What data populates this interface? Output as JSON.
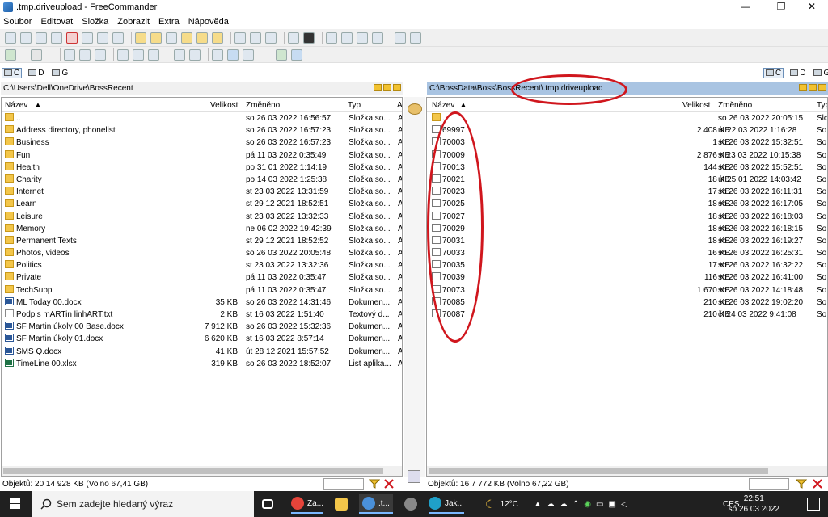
{
  "window": {
    "title": ".tmp.driveupload - FreeCommander",
    "controls": [
      "—",
      "❐",
      "✕"
    ]
  },
  "menu": [
    "Soubor",
    "Editovat",
    "Složka",
    "Zobrazit",
    "Extra",
    "Nápověda"
  ],
  "drives": [
    "C",
    "D",
    "G"
  ],
  "left_panel": {
    "path": "C:\\Users\\Dell\\OneDrive\\BossRecent",
    "columns": {
      "name": "Název",
      "size": "Velikost",
      "modified": "Změněno",
      "type": "Typ",
      "attr": "A"
    },
    "rows": [
      {
        "icon": "folder",
        "name": "..",
        "size": "",
        "modified": "so 26 03 2022 16:56:57",
        "type": "Složka so...",
        "attr": "A"
      },
      {
        "icon": "folder",
        "name": "Address directory, phonelist",
        "size": "",
        "modified": "so 26 03 2022 16:57:23",
        "type": "Složka so...",
        "attr": "A"
      },
      {
        "icon": "folder",
        "name": "Business",
        "size": "",
        "modified": "so 26 03 2022 16:57:23",
        "type": "Složka so...",
        "attr": "A"
      },
      {
        "icon": "folder",
        "name": "Fun",
        "size": "",
        "modified": "pá 11 03 2022 0:35:49",
        "type": "Složka so...",
        "attr": "A"
      },
      {
        "icon": "folder",
        "name": "Health",
        "size": "",
        "modified": "po 31 01 2022 1:14:19",
        "type": "Složka so...",
        "attr": "A"
      },
      {
        "icon": "folder",
        "name": "Charity",
        "size": "",
        "modified": "po 14 03 2022 1:25:38",
        "type": "Složka so...",
        "attr": "A"
      },
      {
        "icon": "folder",
        "name": "Internet",
        "size": "",
        "modified": "st 23 03 2022 13:31:59",
        "type": "Složka so...",
        "attr": "A"
      },
      {
        "icon": "folder",
        "name": "Learn",
        "size": "",
        "modified": "st 29 12 2021 18:52:51",
        "type": "Složka so...",
        "attr": "A"
      },
      {
        "icon": "folder",
        "name": "Leisure",
        "size": "",
        "modified": "st 23 03 2022 13:32:33",
        "type": "Složka so...",
        "attr": "A"
      },
      {
        "icon": "folder",
        "name": "Memory",
        "size": "",
        "modified": "ne 06 02 2022 19:42:39",
        "type": "Složka so...",
        "attr": "A"
      },
      {
        "icon": "folder",
        "name": "Permanent Texts",
        "size": "",
        "modified": "st 29 12 2021 18:52:52",
        "type": "Složka so...",
        "attr": "A"
      },
      {
        "icon": "folder",
        "name": "Photos, videos",
        "size": "",
        "modified": "so 26 03 2022 20:05:48",
        "type": "Složka so...",
        "attr": "A"
      },
      {
        "icon": "folder",
        "name": "Politics",
        "size": "",
        "modified": "st 23 03 2022 13:32:36",
        "type": "Složka so...",
        "attr": "A"
      },
      {
        "icon": "folder",
        "name": "Private",
        "size": "",
        "modified": "pá 11 03 2022 0:35:47",
        "type": "Složka so...",
        "attr": "A"
      },
      {
        "icon": "folder",
        "name": "TechSupp",
        "size": "",
        "modified": "pá 11 03 2022 0:35:47",
        "type": "Složka so...",
        "attr": "A"
      },
      {
        "icon": "doc",
        "name": "ML Today 00.docx",
        "size": "35 KB",
        "modified": "so 26 03 2022 14:31:46",
        "type": "Dokumen...",
        "attr": "A"
      },
      {
        "icon": "txt",
        "name": "Podpis mARTin linhART.txt",
        "size": "2 KB",
        "modified": "st 16 03 2022 1:51:40",
        "type": "Textový d...",
        "attr": "A"
      },
      {
        "icon": "doc",
        "name": "SF Martin úkoly 00 Base.docx",
        "size": "7 912 KB",
        "modified": "so 26 03 2022 15:32:36",
        "type": "Dokumen...",
        "attr": "A"
      },
      {
        "icon": "doc",
        "name": "SF Martin úkoly 01.docx",
        "size": "6 620 KB",
        "modified": "st 16 03 2022 8:57:14",
        "type": "Dokumen...",
        "attr": "A"
      },
      {
        "icon": "doc",
        "name": "SMS Q.docx",
        "size": "41 KB",
        "modified": "út 28 12 2021 15:57:52",
        "type": "Dokumen...",
        "attr": "A"
      },
      {
        "icon": "xls",
        "name": "TimeLine  00.xlsx",
        "size": "319 KB",
        "modified": "so 26 03 2022 18:52:07",
        "type": "List aplika...",
        "attr": "A"
      }
    ],
    "status": "Objektů: 20   14 928 KB     (Volno 67,41 GB)"
  },
  "right_panel": {
    "path": "C:\\BossData\\Boss\\BossRecent\\.tmp.driveupload",
    "columns": {
      "name": "Název",
      "size": "Velikost",
      "modified": "Změněno",
      "type": "Typ"
    },
    "rows": [
      {
        "icon": "folder",
        "name": "..",
        "size": "",
        "modified": "so 26 03 2022 20:05:15",
        "type": "Slo"
      },
      {
        "icon": "file",
        "name": "69997",
        "size": "2 408 KB",
        "modified": "út 22 03 2022 1:16:28",
        "type": "So"
      },
      {
        "icon": "file",
        "name": "70003",
        "size": "1 KB",
        "modified": "so 26 03 2022 15:32:51",
        "type": "So"
      },
      {
        "icon": "file",
        "name": "70009",
        "size": "2 876 KB",
        "modified": "st 23 03 2022 10:15:38",
        "type": "So"
      },
      {
        "icon": "file",
        "name": "70013",
        "size": "144 KB",
        "modified": "so 26 03 2022 15:52:51",
        "type": "So"
      },
      {
        "icon": "file",
        "name": "70021",
        "size": "18 KB",
        "modified": "út 25 01 2022 14:03:42",
        "type": "So"
      },
      {
        "icon": "file",
        "name": "70023",
        "size": "17 KB",
        "modified": "so 26 03 2022 16:11:31",
        "type": "So"
      },
      {
        "icon": "file",
        "name": "70025",
        "size": "18 KB",
        "modified": "so 26 03 2022 16:17:05",
        "type": "So"
      },
      {
        "icon": "file",
        "name": "70027",
        "size": "18 KB",
        "modified": "so 26 03 2022 16:18:03",
        "type": "So"
      },
      {
        "icon": "file",
        "name": "70029",
        "size": "18 KB",
        "modified": "so 26 03 2022 16:18:15",
        "type": "So"
      },
      {
        "icon": "file",
        "name": "70031",
        "size": "18 KB",
        "modified": "so 26 03 2022 16:19:27",
        "type": "So"
      },
      {
        "icon": "file",
        "name": "70033",
        "size": "16 KB",
        "modified": "so 26 03 2022 16:25:31",
        "type": "So"
      },
      {
        "icon": "file",
        "name": "70035",
        "size": "17 KB",
        "modified": "so 26 03 2022 16:32:22",
        "type": "So"
      },
      {
        "icon": "file",
        "name": "70039",
        "size": "116 KB",
        "modified": "so 26 03 2022 16:41:00",
        "type": "So"
      },
      {
        "icon": "file",
        "name": "70073",
        "size": "1 670 KB",
        "modified": "so 26 03 2022 14:18:48",
        "type": "So"
      },
      {
        "icon": "file",
        "name": "70085",
        "size": "210 KB",
        "modified": "so 26 03 2022 19:02:20",
        "type": "So"
      },
      {
        "icon": "file",
        "name": "70087",
        "size": "210 KB",
        "modified": "čt 24 03 2022 9:41:08",
        "type": "So"
      }
    ],
    "status": "Objektů: 16   7 772 KB     (Volno 67,22 GB)"
  },
  "taskbar": {
    "search_placeholder": "Sem zadejte hledaný výraz",
    "items": [
      "Za...",
      ".t...",
      "Jak..."
    ],
    "weather": "12°C",
    "lang": "CES",
    "time": "22:51",
    "date": "so 26 03 2022"
  },
  "colors": {
    "annotation": "#d0161d",
    "path_active_bg": "#a9c4e2"
  }
}
